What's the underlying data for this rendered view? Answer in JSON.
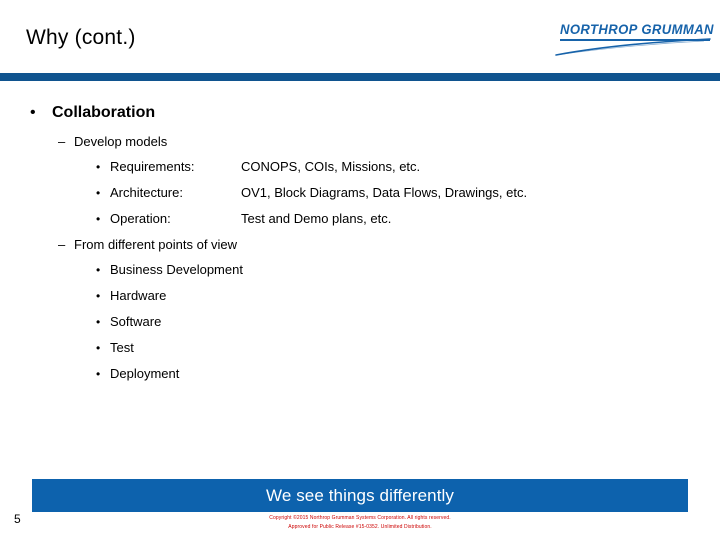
{
  "slide": {
    "title": "Why (cont.)",
    "page_number": "5"
  },
  "logo": {
    "wordmark": "NORTHROP GRUMMAN",
    "color": "#1763aa"
  },
  "theme": {
    "header_rule_color": "#10548f",
    "banner_color": "#0d62ad",
    "legal_color": "#cc0000"
  },
  "bullets": {
    "level1_mark": "•",
    "level2_mark": "–",
    "level3_mark": "•",
    "topic": "Collaboration",
    "group_a": {
      "heading": "Develop models",
      "items": [
        {
          "label": "Requirements:",
          "value": "CONOPS, COIs, Missions, etc."
        },
        {
          "label": "Architecture:",
          "value": "OV1, Block Diagrams, Data Flows, Drawings, etc."
        },
        {
          "label": "Operation:",
          "value": "Test and Demo plans, etc."
        }
      ]
    },
    "group_b": {
      "heading": "From different points of view",
      "items": [
        "Business Development",
        "Hardware",
        "Software",
        "Test",
        "Deployment"
      ]
    }
  },
  "banner": {
    "tagline": "We see things differently"
  },
  "legal": {
    "line1": "Copyright ©2015 Northrop Grumman Systems Corporation. All rights reserved.",
    "line2": "Approved for Public Release #15-0352. Unlimited Distribution."
  }
}
